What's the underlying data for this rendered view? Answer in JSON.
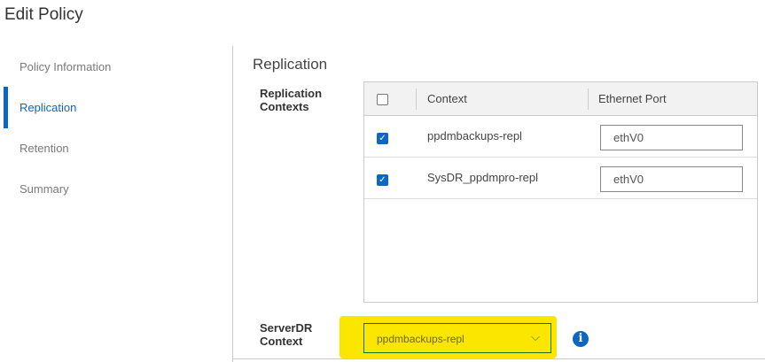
{
  "title": "Edit Policy",
  "sidebar": {
    "items": [
      {
        "label": "Policy Information"
      },
      {
        "label": "Replication",
        "active": true
      },
      {
        "label": "Retention"
      },
      {
        "label": "Summary"
      }
    ]
  },
  "section": {
    "title": "Replication",
    "replication_contexts_label": "Replication Contexts",
    "table": {
      "columns": [
        "Context",
        "Ethernet Port"
      ],
      "select_all": false,
      "rows": [
        {
          "checked": true,
          "context": "ppdmbackups-repl",
          "port": "ethV0"
        },
        {
          "checked": true,
          "context": "SysDR_ppdmpro-repl",
          "port": "ethV0"
        }
      ]
    },
    "serverdr_label": "ServerDR Context",
    "serverdr_value": "ppdmbackups-repl"
  },
  "colors": {
    "accent": "#0d66c2",
    "highlight": "#fbe600"
  }
}
